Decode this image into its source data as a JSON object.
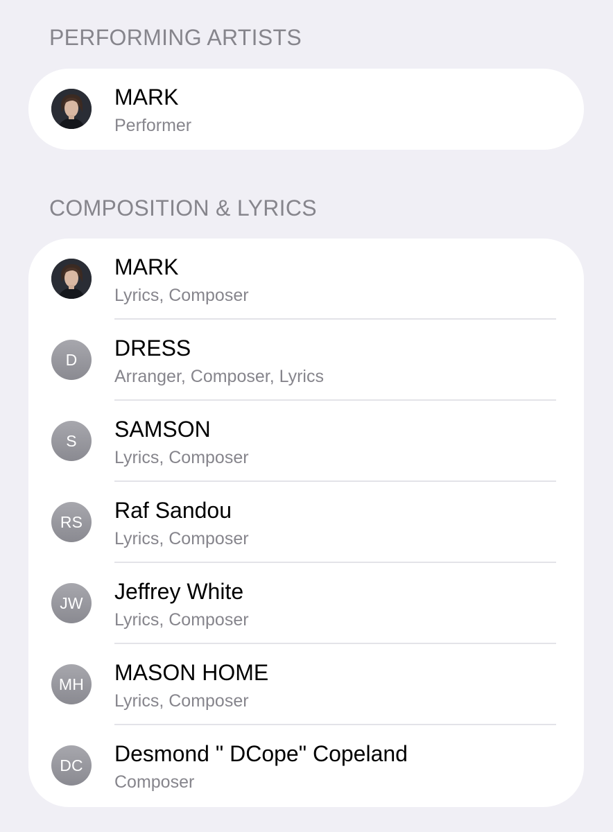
{
  "sections": [
    {
      "header": "PERFORMING ARTISTS",
      "items": [
        {
          "avatar_type": "photo",
          "avatar_icon": "portrait-photo-icon",
          "name": "MARK",
          "role": "Performer"
        }
      ]
    },
    {
      "header": "COMPOSITION & LYRICS",
      "items": [
        {
          "avatar_type": "photo",
          "avatar_icon": "portrait-photo-icon",
          "name": "MARK",
          "role": "Lyrics, Composer"
        },
        {
          "avatar_type": "initials",
          "initials": "D",
          "name": "DRESS",
          "role": "Arranger, Composer, Lyrics"
        },
        {
          "avatar_type": "initials",
          "initials": "S",
          "name": "SAMSON",
          "role": "Lyrics, Composer"
        },
        {
          "avatar_type": "initials",
          "initials": "RS",
          "name": "Raf Sandou",
          "role": "Lyrics, Composer"
        },
        {
          "avatar_type": "initials",
          "initials": "JW",
          "name": "Jeffrey White",
          "role": "Lyrics, Composer"
        },
        {
          "avatar_type": "initials",
          "initials": "MH",
          "name": "MASON HOME",
          "role": "Lyrics, Composer"
        },
        {
          "avatar_type": "initials",
          "initials": "DC",
          "name": "Desmond \" DCope\" Copeland",
          "role": "Composer"
        }
      ]
    }
  ],
  "colors": {
    "background": "#f0eff5",
    "card": "#ffffff",
    "secondary_text": "#86858c",
    "avatar_gray": "#9a9aa0"
  }
}
